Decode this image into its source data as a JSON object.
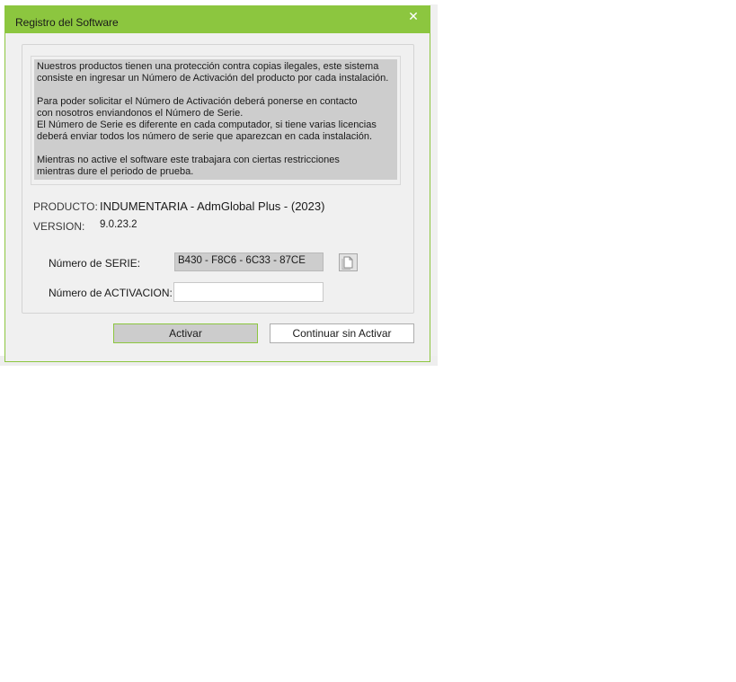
{
  "window": {
    "title": "Registro del Software",
    "close_glyph": "✕",
    "accent_color": "#8cc63f"
  },
  "info": {
    "text": "Nuestros productos tienen una protección contra copias ilegales, este sistema\nconsiste en ingresar un Número de Activación del producto por cada instalación.\n\nPara poder solicitar el Número de Activación deberá ponerse en contacto\ncon nosotros enviandonos el Número de Serie.\nEl Número de Serie es diferente en cada computador, si tiene varias licencias\ndeberá enviar todos los número de serie que aparezcan en cada instalación.\n\nMientras no active el software este trabajara con ciertas restricciones\nmientras dure el periodo de prueba."
  },
  "product": {
    "label": "PRODUCTO:",
    "value": "INDUMENTARIA - AdmGlobal Plus - (2023)"
  },
  "version": {
    "label": "VERSION:",
    "value": "9.0.23.2"
  },
  "serial": {
    "label": "Número de SERIE:",
    "value": "B430 - F8C6 - 6C33 - 87CE",
    "copy_icon": "copy-icon"
  },
  "activation": {
    "label": "Número de ACTIVACION:",
    "value": "",
    "placeholder": ""
  },
  "buttons": {
    "activate": "Activar",
    "continue": "Continuar sin Activar"
  }
}
